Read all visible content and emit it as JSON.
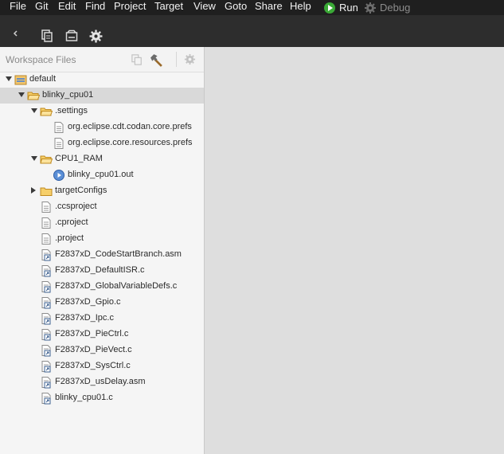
{
  "menubar": {
    "items": [
      "File",
      "Git",
      "Edit",
      "Find",
      "Project",
      "Target",
      "View",
      "Goto",
      "Share",
      "Help"
    ],
    "run_label": "Run",
    "debug_label": "Debug"
  },
  "explorer": {
    "title": "Workspace Files",
    "tree": [
      {
        "label": "default",
        "icon": "workspace-icon",
        "twisty": "expanded",
        "selected": false
      },
      {
        "label": "blinky_cpu01",
        "icon": "folder-open-icon",
        "twisty": "expanded",
        "selected": true
      },
      {
        "label": ".settings",
        "icon": "folder-open-icon",
        "twisty": "expanded",
        "selected": false
      },
      {
        "label": "org.eclipse.cdt.codan.core.prefs",
        "icon": "file-icon",
        "twisty": "none",
        "selected": false
      },
      {
        "label": "org.eclipse.core.resources.prefs",
        "icon": "file-icon",
        "twisty": "none",
        "selected": false
      },
      {
        "label": "CPU1_RAM",
        "icon": "folder-open-icon",
        "twisty": "expanded",
        "selected": false
      },
      {
        "label": "blinky_cpu01.out",
        "icon": "executable-icon",
        "twisty": "none",
        "selected": false
      },
      {
        "label": "targetConfigs",
        "icon": "folder-icon",
        "twisty": "collapsed",
        "selected": false
      },
      {
        "label": ".ccsproject",
        "icon": "file-icon",
        "twisty": "none",
        "selected": false
      },
      {
        "label": ".cproject",
        "icon": "file-icon",
        "twisty": "none",
        "selected": false
      },
      {
        "label": ".project",
        "icon": "file-icon",
        "twisty": "none",
        "selected": false
      },
      {
        "label": "F2837xD_CodeStartBranch.asm",
        "icon": "linked-file-icon",
        "twisty": "none",
        "selected": false
      },
      {
        "label": "F2837xD_DefaultISR.c",
        "icon": "linked-file-icon",
        "twisty": "none",
        "selected": false
      },
      {
        "label": "F2837xD_GlobalVariableDefs.c",
        "icon": "linked-file-icon",
        "twisty": "none",
        "selected": false
      },
      {
        "label": "F2837xD_Gpio.c",
        "icon": "linked-file-icon",
        "twisty": "none",
        "selected": false
      },
      {
        "label": "F2837xD_Ipc.c",
        "icon": "linked-file-icon",
        "twisty": "none",
        "selected": false
      },
      {
        "label": "F2837xD_PieCtrl.c",
        "icon": "linked-file-icon",
        "twisty": "none",
        "selected": false
      },
      {
        "label": "F2837xD_PieVect.c",
        "icon": "linked-file-icon",
        "twisty": "none",
        "selected": false
      },
      {
        "label": "F2837xD_SysCtrl.c",
        "icon": "linked-file-icon",
        "twisty": "none",
        "selected": false
      },
      {
        "label": "F2837xD_usDelay.asm",
        "icon": "linked-file-icon",
        "twisty": "none",
        "selected": false
      },
      {
        "label": "blinky_cpu01.c",
        "icon": "linked-file-icon",
        "twisty": "none",
        "selected": false
      }
    ]
  },
  "colors": {
    "menubar_bg": "#1f1f1f",
    "toolbar_bg": "#2d2d2d",
    "run_green": "#3aa936",
    "selection": "#d9d9d9",
    "folder": "#e8b23a",
    "editor_bg": "#dedede"
  }
}
